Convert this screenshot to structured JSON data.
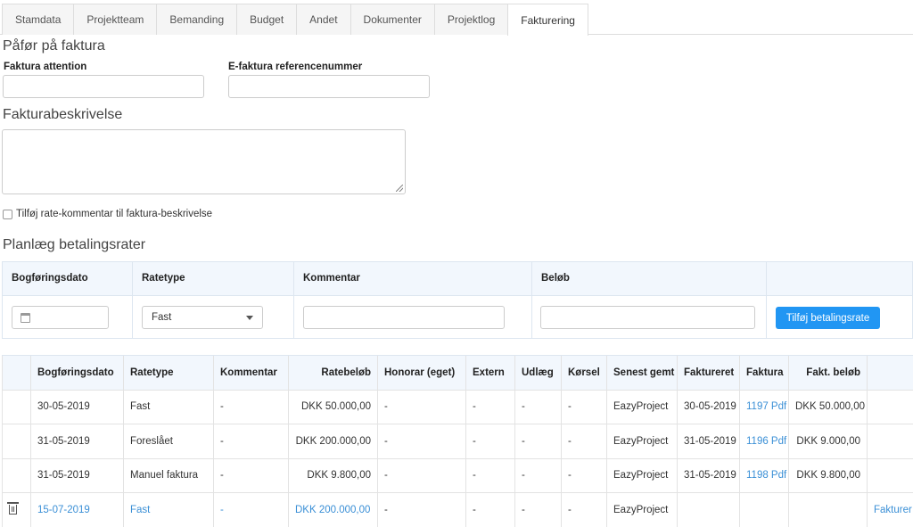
{
  "tabs": [
    {
      "label": "Stamdata"
    },
    {
      "label": "Projektteam"
    },
    {
      "label": "Bemanding"
    },
    {
      "label": "Budget"
    },
    {
      "label": "Andet"
    },
    {
      "label": "Dokumenter"
    },
    {
      "label": "Projektlog"
    },
    {
      "label": "Fakturering"
    }
  ],
  "active_tab": "Fakturering",
  "invoice_section": {
    "title": "Påfør på faktura",
    "attention_label": "Faktura attention",
    "attention_value": "",
    "eref_label": "E-faktura referencenummer",
    "eref_value": ""
  },
  "description_section": {
    "title": "Fakturabeskrivelse",
    "value": ""
  },
  "rate_comment_checkbox": {
    "label": "Tilføj rate-kommentar til faktura-beskrivelse",
    "checked": false
  },
  "plan_section": {
    "title": "Planlæg betalingsrater",
    "headers": {
      "date": "Bogføringsdato",
      "type": "Ratetype",
      "comment": "Kommentar",
      "amount": "Beløb"
    },
    "ratetype_selected": "Fast",
    "add_button": "Tilføj betalingsrate",
    "date_icon": "calendar-icon"
  },
  "rates_table": {
    "headers": [
      "",
      "Bogføringsdato",
      "Ratetype",
      "Kommentar",
      "Ratebeløb",
      "Honorar (eget)",
      "Extern",
      "Udlæg",
      "Kørsel",
      "Senest gemt",
      "Faktureret",
      "Faktura",
      "Fakt. beløb",
      ""
    ],
    "rows": [
      {
        "action": "",
        "date": "30-05-2019",
        "type": "Fast",
        "comment": "-",
        "amount": "DKK 50.000,00",
        "fee": "-",
        "extern": "-",
        "outlay": "-",
        "mileage": "-",
        "saved_by": "EazyProject",
        "invoiced": "30-05-2019",
        "invoice": "1197 Pdf",
        "invoice_amount": "DKK 50.000,00",
        "invoice_action": ""
      },
      {
        "action": "",
        "date": "31-05-2019",
        "type": "Foreslået",
        "comment": "-",
        "amount": "DKK 200.000,00",
        "fee": "-",
        "extern": "-",
        "outlay": "-",
        "mileage": "-",
        "saved_by": "EazyProject",
        "invoiced": "31-05-2019",
        "invoice": "1196 Pdf",
        "invoice_amount": "DKK 9.000,00",
        "invoice_action": ""
      },
      {
        "action": "",
        "date": "31-05-2019",
        "type": "Manuel faktura",
        "comment": "-",
        "amount": "DKK 9.800,00",
        "fee": "-",
        "extern": "-",
        "outlay": "-",
        "mileage": "-",
        "saved_by": "EazyProject",
        "invoiced": "31-05-2019",
        "invoice": "1198 Pdf",
        "invoice_amount": "DKK 9.800,00",
        "invoice_action": ""
      },
      {
        "action": "trash-icon",
        "date": "15-07-2019",
        "type": "Fast",
        "comment": "-",
        "amount": "DKK 200.000,00",
        "fee": "-",
        "extern": "-",
        "outlay": "-",
        "mileage": "-",
        "saved_by": "EazyProject",
        "invoiced": "",
        "invoice": "",
        "invoice_amount": "",
        "invoice_action": "Fakturer"
      }
    ]
  },
  "colors": {
    "accent": "#2196f3",
    "link": "#3a8fd6",
    "header_bg": "#f2f7fd"
  }
}
